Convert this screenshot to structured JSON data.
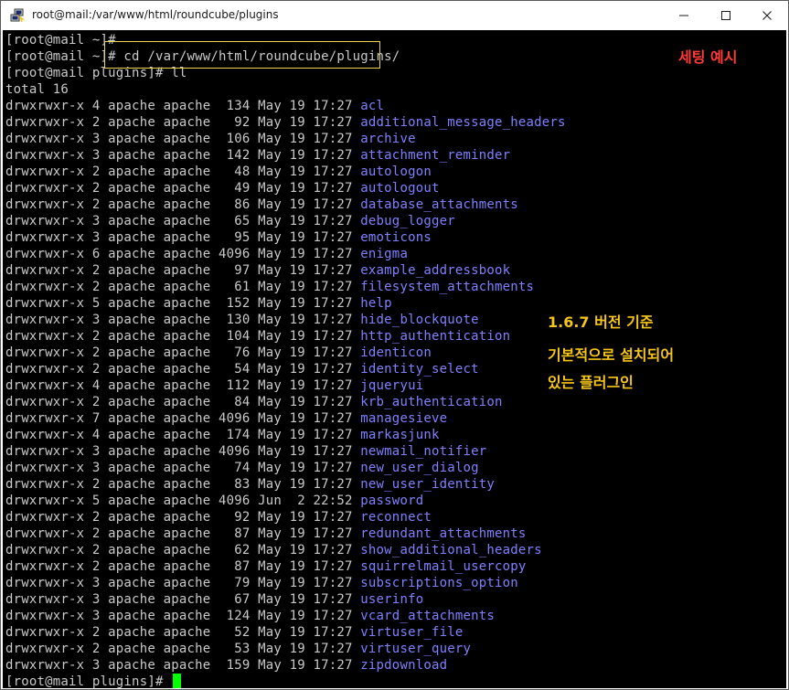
{
  "window": {
    "title": "root@mail:/var/www/html/roundcube/plugins",
    "icons": {
      "app": "putty-icon",
      "minimize": "minimize-icon",
      "maximize": "maximize-icon",
      "close": "close-icon"
    }
  },
  "terminal": {
    "colors": {
      "background": "#000000",
      "text": "#c9c9c9",
      "directory": "#8080ff",
      "cursor": "#00ff00",
      "highlight_box": "#e8d44d"
    },
    "prompt_lines": [
      "[root@mail ~]#",
      "[root@mail ~]# cd /var/www/html/roundcube/plugins/",
      "[root@mail plugins]# ll",
      "total 16"
    ],
    "listing": [
      {
        "meta": "drwxrwxr-x 4 apache apache  134 May 19 17:27 ",
        "name": "acl"
      },
      {
        "meta": "drwxrwxr-x 2 apache apache   92 May 19 17:27 ",
        "name": "additional_message_headers"
      },
      {
        "meta": "drwxrwxr-x 3 apache apache  106 May 19 17:27 ",
        "name": "archive"
      },
      {
        "meta": "drwxrwxr-x 3 apache apache  142 May 19 17:27 ",
        "name": "attachment_reminder"
      },
      {
        "meta": "drwxrwxr-x 2 apache apache   48 May 19 17:27 ",
        "name": "autologon"
      },
      {
        "meta": "drwxrwxr-x 2 apache apache   49 May 19 17:27 ",
        "name": "autologout"
      },
      {
        "meta": "drwxrwxr-x 2 apache apache   86 May 19 17:27 ",
        "name": "database_attachments"
      },
      {
        "meta": "drwxrwxr-x 3 apache apache   65 May 19 17:27 ",
        "name": "debug_logger"
      },
      {
        "meta": "drwxrwxr-x 3 apache apache   95 May 19 17:27 ",
        "name": "emoticons"
      },
      {
        "meta": "drwxrwxr-x 6 apache apache 4096 May 19 17:27 ",
        "name": "enigma"
      },
      {
        "meta": "drwxrwxr-x 2 apache apache   97 May 19 17:27 ",
        "name": "example_addressbook"
      },
      {
        "meta": "drwxrwxr-x 2 apache apache   61 May 19 17:27 ",
        "name": "filesystem_attachments"
      },
      {
        "meta": "drwxrwxr-x 5 apache apache  152 May 19 17:27 ",
        "name": "help"
      },
      {
        "meta": "drwxrwxr-x 3 apache apache  130 May 19 17:27 ",
        "name": "hide_blockquote"
      },
      {
        "meta": "drwxrwxr-x 2 apache apache  104 May 19 17:27 ",
        "name": "http_authentication"
      },
      {
        "meta": "drwxrwxr-x 2 apache apache   76 May 19 17:27 ",
        "name": "identicon"
      },
      {
        "meta": "drwxrwxr-x 2 apache apache   54 May 19 17:27 ",
        "name": "identity_select"
      },
      {
        "meta": "drwxrwxr-x 4 apache apache  112 May 19 17:27 ",
        "name": "jqueryui"
      },
      {
        "meta": "drwxrwxr-x 2 apache apache   84 May 19 17:27 ",
        "name": "krb_authentication"
      },
      {
        "meta": "drwxrwxr-x 7 apache apache 4096 May 19 17:27 ",
        "name": "managesieve"
      },
      {
        "meta": "drwxrwxr-x 4 apache apache  174 May 19 17:27 ",
        "name": "markasjunk"
      },
      {
        "meta": "drwxrwxr-x 3 apache apache 4096 May 19 17:27 ",
        "name": "newmail_notifier"
      },
      {
        "meta": "drwxrwxr-x 3 apache apache   74 May 19 17:27 ",
        "name": "new_user_dialog"
      },
      {
        "meta": "drwxrwxr-x 2 apache apache   83 May 19 17:27 ",
        "name": "new_user_identity"
      },
      {
        "meta": "drwxrwxr-x 5 apache apache 4096 Jun  2 22:52 ",
        "name": "password"
      },
      {
        "meta": "drwxrwxr-x 2 apache apache   92 May 19 17:27 ",
        "name": "reconnect"
      },
      {
        "meta": "drwxrwxr-x 2 apache apache   87 May 19 17:27 ",
        "name": "redundant_attachments"
      },
      {
        "meta": "drwxrwxr-x 2 apache apache   62 May 19 17:27 ",
        "name": "show_additional_headers"
      },
      {
        "meta": "drwxrwxr-x 2 apache apache   87 May 19 17:27 ",
        "name": "squirrelmail_usercopy"
      },
      {
        "meta": "drwxrwxr-x 3 apache apache   79 May 19 17:27 ",
        "name": "subscriptions_option"
      },
      {
        "meta": "drwxrwxr-x 3 apache apache   67 May 19 17:27 ",
        "name": "userinfo"
      },
      {
        "meta": "drwxrwxr-x 3 apache apache  124 May 19 17:27 ",
        "name": "vcard_attachments"
      },
      {
        "meta": "drwxrwxr-x 2 apache apache   52 May 19 17:27 ",
        "name": "virtuser_file"
      },
      {
        "meta": "drwxrwxr-x 2 apache apache   53 May 19 17:27 ",
        "name": "virtuser_query"
      },
      {
        "meta": "drwxrwxr-x 3 apache apache  159 May 19 17:27 ",
        "name": "zipdownload"
      }
    ],
    "final_prompt": "[root@mail plugins]# "
  },
  "annotations": {
    "top_right": {
      "text": "세팅 예시",
      "color": "#ff3b3b"
    },
    "middle": {
      "color": "#f5c518",
      "lines": [
        "1.6.7 버전 기준",
        "기본적으로 설치되어",
        "있는 플러그인"
      ]
    }
  }
}
